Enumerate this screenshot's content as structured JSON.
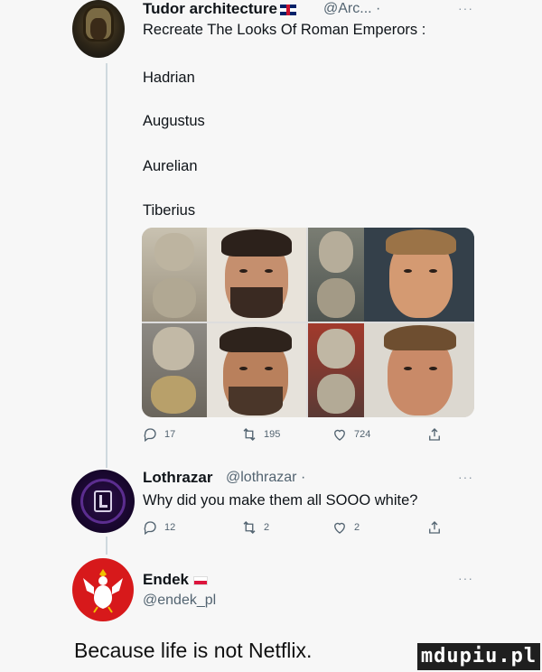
{
  "colors": {
    "background": "#f7f7f7",
    "thread_line": "#cfd9de",
    "secondary_text": "#536471",
    "endek_avatar_red": "#d7191b",
    "lothrazar_avatar_purple": "#2b0f4a"
  },
  "tweet1": {
    "author_name": "Tudor architecture",
    "handle": "@Arc... ·",
    "more": "···",
    "lines": [
      "Recreate The Looks Of Roman Emperors :",
      "Hadrian",
      "Augustus",
      "Aurelian",
      "Tiberius"
    ],
    "actions": {
      "reply_count": "17",
      "retweet_count": "195",
      "like_count": "724"
    },
    "icons": [
      "reply-icon",
      "retweet-icon",
      "like-icon",
      "share-icon"
    ]
  },
  "tweet2": {
    "author_name": "Lothrazar",
    "handle": "@lothrazar ·",
    "more": "···",
    "text": "Why did you make them all SOOO white?",
    "actions": {
      "reply_count": "12",
      "retweet_count": "2",
      "like_count": "2"
    }
  },
  "tweet3": {
    "author_name": "Endek",
    "handle": "@endek_pl",
    "more": "···"
  },
  "caption": "Because life is not Netflix.",
  "watermark": "mdupiu.pl"
}
